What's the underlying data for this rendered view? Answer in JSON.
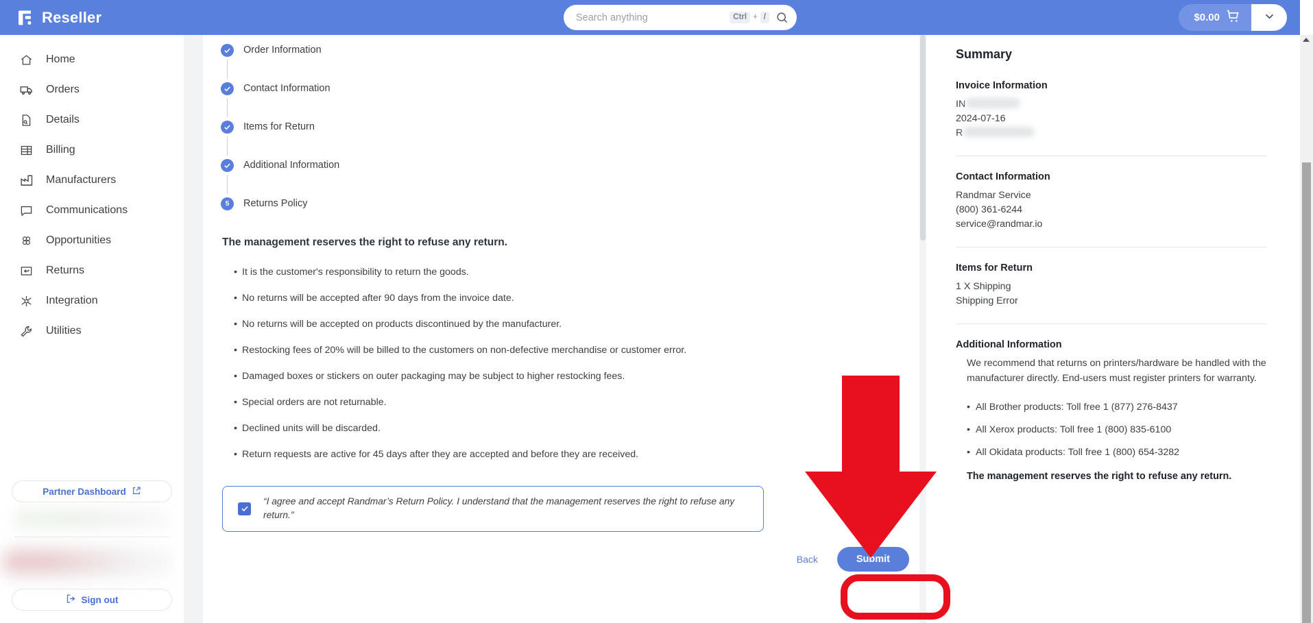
{
  "header": {
    "brand": "Reseller",
    "logo_icon": "reseller-logo-icon",
    "search": {
      "placeholder": "Search anything",
      "value": "",
      "kbd_ctrl": "Ctrl",
      "kbd_plus": "+",
      "kbd_slash": "/",
      "icon": "search-icon"
    },
    "cart": {
      "amount": "$0.00",
      "icon": "shopping-cart-icon",
      "caret_icon": "chevron-down-icon"
    }
  },
  "sidebar": {
    "items": [
      {
        "label": "Home",
        "icon": "home-icon"
      },
      {
        "label": "Orders",
        "icon": "truck-icon"
      },
      {
        "label": "Details",
        "icon": "document-search-icon"
      },
      {
        "label": "Billing",
        "icon": "invoice-icon"
      },
      {
        "label": "Manufacturers",
        "icon": "factory-icon"
      },
      {
        "label": "Communications",
        "icon": "chat-bubble-icon"
      },
      {
        "label": "Opportunities",
        "icon": "clover-icon"
      },
      {
        "label": "Returns",
        "icon": "return-arrow-icon"
      },
      {
        "label": "Integration",
        "icon": "integration-icon"
      },
      {
        "label": "Utilities",
        "icon": "wrench-icon"
      }
    ],
    "partner_dashboard": {
      "label": "Partner Dashboard",
      "icon": "external-link-icon"
    },
    "sign_out": {
      "label": "Sign out",
      "icon": "logout-icon"
    }
  },
  "stepper": {
    "steps": [
      {
        "label": "Order Information",
        "state": "complete",
        "badge": "✓"
      },
      {
        "label": "Contact Information",
        "state": "complete",
        "badge": "✓"
      },
      {
        "label": "Items for Return",
        "state": "complete",
        "badge": "✓"
      },
      {
        "label": "Additional Information",
        "state": "complete",
        "badge": "✓"
      },
      {
        "label": "Returns Policy",
        "state": "active",
        "badge": "5"
      }
    ]
  },
  "policy": {
    "title": "The management reserves the right to refuse any return.",
    "bullets": [
      "It is the customer's responsibility to return the goods.",
      "No returns will be accepted after 90 days from the invoice date.",
      "No returns will be accepted on products discontinued by the manufacturer.",
      "Restocking fees of 20% will be billed to the customers on non-defective merchandise or customer error.",
      "Damaged boxes or stickers on outer packaging may be subject to higher restocking fees.",
      "Special orders are not returnable.",
      "Declined units will be discarded.",
      "Return requests are active for 45 days after they are accepted and before they are received."
    ],
    "agreement": "“I agree and accept Randmar’s Return Policy. I understand that the management reserves the right to refuse any return.”",
    "agreement_checked": true,
    "checkbox_icon": "checkmark-icon"
  },
  "actions": {
    "back_label": "Back",
    "submit_label": "Submit"
  },
  "summary": {
    "title": "Summary",
    "invoice": {
      "heading": "Invoice Information",
      "number_prefix": "IN",
      "number_redacted": true,
      "date": "2024-07-16",
      "ref_prefix": "R",
      "ref_redacted": true
    },
    "contact": {
      "heading": "Contact Information",
      "name": "Randmar Service",
      "phone": "(800) 361-6244",
      "email": "service@randmar.io"
    },
    "items": {
      "heading": "Items for Return",
      "line1": "1 X Shipping",
      "line2": "Shipping Error"
    },
    "additional": {
      "heading": "Additional Information",
      "paragraph": "We recommend that returns on printers/hardware be handled with the manufacturer directly. End-users must register printers for warranty.",
      "bullets": [
        "All Brother products: Toll free 1 (877) 276-8437",
        "All Xerox products: Toll free 1 (800) 835-6100",
        "All Okidata products: Toll free 1 (800) 654-3282"
      ],
      "footer": "The management reserves the right to refuse any return."
    }
  },
  "annotations": {
    "arrow": {
      "name": "red-down-arrow-annotation",
      "color": "#e8101f",
      "direction": "down"
    },
    "ring": {
      "name": "red-highlight-box-annotation",
      "color": "#e8101f",
      "targets": "submit-button"
    }
  },
  "colors": {
    "brand_blue": "#5a80dd",
    "accent_blue": "#5a7fdb",
    "annotation_red": "#e8101f"
  }
}
